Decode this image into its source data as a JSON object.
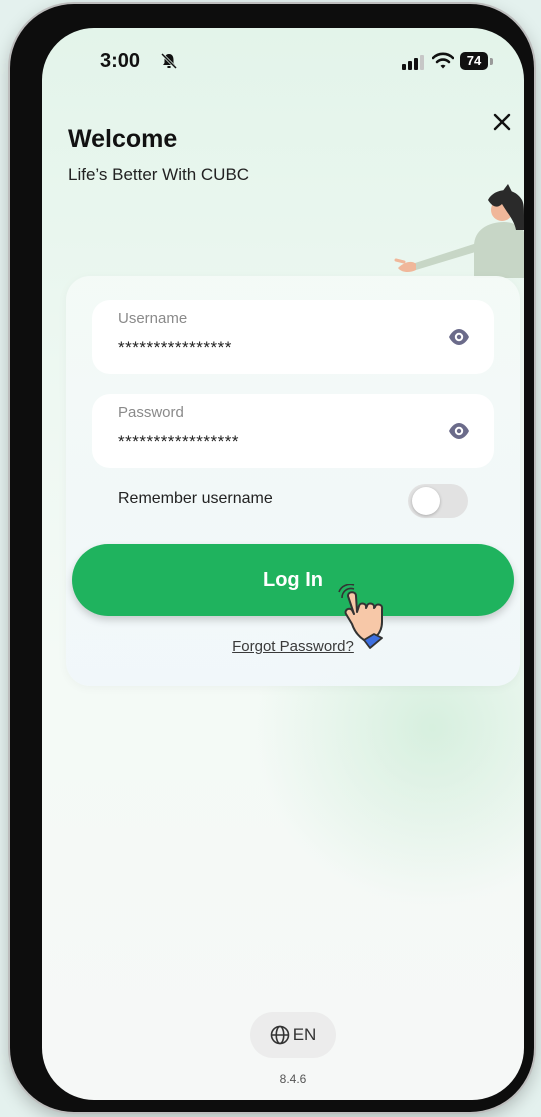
{
  "status_bar": {
    "time": "3:00",
    "battery": "74"
  },
  "header": {
    "title": "Welcome",
    "subtitle": "Life’s Better With CUBC"
  },
  "form": {
    "username": {
      "label": "Username",
      "value": "****************"
    },
    "password": {
      "label": "Password",
      "value": "*****************"
    },
    "remember_label": "Remember username",
    "remember_on": false,
    "login_label": "Log In",
    "forgot_label": "Forgot Password?"
  },
  "footer": {
    "language": "EN",
    "version": "8.4.6"
  },
  "colors": {
    "accent": "#1fb35e",
    "eye": "#6b6b8a",
    "cursor_hand": "#f7c8a8",
    "cursor_cuff": "#3d6fe0"
  },
  "icons": [
    "bell-slash-icon",
    "signal-icon",
    "wifi-icon",
    "battery-icon",
    "close-icon",
    "eye-icon",
    "globe-icon",
    "hand-pointer-icon"
  ]
}
